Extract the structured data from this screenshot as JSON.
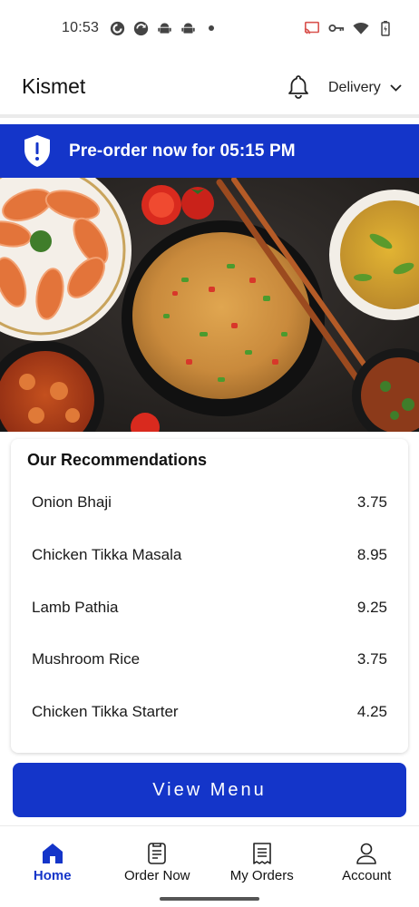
{
  "status_bar": {
    "time": "10:53",
    "left_icons": [
      "pocket-casts-icon",
      "sync-icon",
      "android-icon",
      "android-icon",
      "dot-icon"
    ],
    "right_icons": [
      "cast-icon",
      "vpn-key-icon",
      "wifi-icon",
      "battery-icon"
    ]
  },
  "header": {
    "title": "Kismet",
    "delivery_label": "Delivery"
  },
  "banner": {
    "text": "Pre-order now for 05:15 PM",
    "color": "#1435c9"
  },
  "recommendations": {
    "title": "Our Recommendations",
    "items": [
      {
        "name": "Onion Bhaji",
        "price": "3.75"
      },
      {
        "name": "Chicken Tikka Masala",
        "price": "8.95"
      },
      {
        "name": "Lamb Pathia",
        "price": "9.25"
      },
      {
        "name": "Mushroom Rice",
        "price": "3.75"
      },
      {
        "name": "Chicken Tikka Starter",
        "price": "4.25"
      }
    ]
  },
  "view_menu_label": "View Menu",
  "bottom_nav": {
    "items": [
      {
        "label": "Home",
        "icon": "home-icon",
        "active": true
      },
      {
        "label": "Order Now",
        "icon": "order-doc-icon",
        "active": false
      },
      {
        "label": "My Orders",
        "icon": "receipt-icon",
        "active": false
      },
      {
        "label": "Account",
        "icon": "person-icon",
        "active": false
      }
    ]
  }
}
